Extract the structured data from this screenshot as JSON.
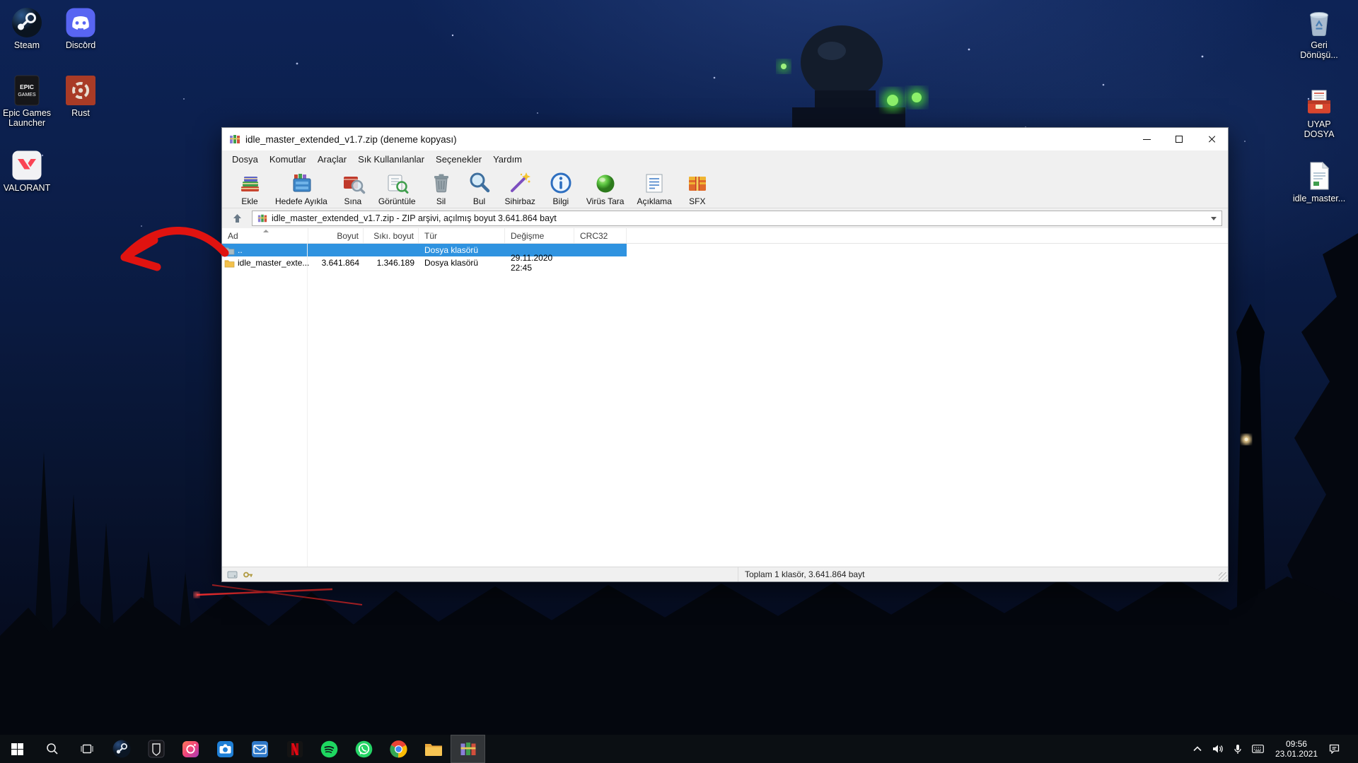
{
  "colors": {
    "selection_blue": "#2f93e0",
    "annotation_red": "#e01310",
    "taskbar_dark": "#0b0f14"
  },
  "desktop": {
    "icons_left": [
      {
        "icon": "steam",
        "label": "Steam"
      },
      {
        "icon": "discord",
        "label": "Discord"
      },
      {
        "icon": "epic-games",
        "label": "Epic Games Launcher"
      },
      {
        "icon": "rust",
        "label": "Rust"
      },
      {
        "icon": "valorant",
        "label": "VALORANT"
      }
    ],
    "icons_right": [
      {
        "icon": "recycle-bin",
        "label": "Geri Dönüşü..."
      },
      {
        "icon": "uyap-box",
        "label": "UYAP DOSYA"
      },
      {
        "icon": "document",
        "label": "idle_master..."
      }
    ]
  },
  "winrar": {
    "title": "idle_master_extended_v1.7.zip (deneme kopyası)",
    "menu": [
      "Dosya",
      "Komutlar",
      "Araçlar",
      "Sık Kullanılanlar",
      "Seçenekler",
      "Yardım"
    ],
    "toolbar": [
      "Ekle",
      "Hedefe Ayıkla",
      "Sına",
      "Görüntüle",
      "Sil",
      "Bul",
      "Sihirbaz",
      "Bilgi",
      "Virüs Tara",
      "Açıklama",
      "SFX"
    ],
    "toolbar_icons": [
      "add",
      "extract-to",
      "test",
      "view",
      "delete",
      "find",
      "wizard",
      "info",
      "virus-scan",
      "comment",
      "sfx"
    ],
    "address": "idle_master_extended_v1.7.zip - ZIP arşivi, açılmış boyut 3.641.864 bayt",
    "columns": [
      "Ad",
      "Boyut",
      "Sıkı. boyut",
      "Tür",
      "Değişme",
      "CRC32"
    ],
    "rows": [
      {
        "name": "..",
        "size": "",
        "packed": "",
        "type": "Dosya klasörü",
        "modified": "",
        "crc": "",
        "selected": true,
        "icon": "folder-up-gray"
      },
      {
        "name": "idle_master_exte...",
        "size": "3.641.864",
        "packed": "1.346.189",
        "type": "Dosya klasörü",
        "modified": "29.11.2020 22:45",
        "crc": "",
        "selected": false,
        "icon": "folder-yellow"
      }
    ],
    "status": {
      "total": "Toplam 1 klasör, 3.641.864 bayt"
    }
  },
  "taskbar": {
    "apps": [
      "start",
      "search",
      "task-view",
      "steam",
      "epic-games",
      "pink-app",
      "camera",
      "mail",
      "netflix",
      "spotify",
      "whatsapp",
      "chrome",
      "file-explorer",
      "winrar"
    ],
    "active_app": "winrar",
    "clock": {
      "time": "09:56",
      "date": "23.01.2021"
    }
  }
}
